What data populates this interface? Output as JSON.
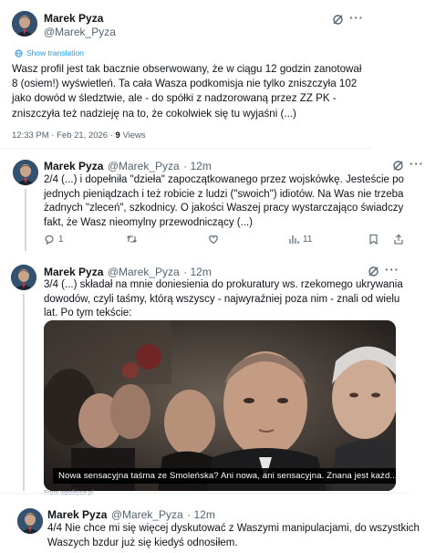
{
  "post1": {
    "author_name": "Marek Pyza",
    "author_handle": "@Marek_Pyza",
    "show_translation": "Show translation",
    "text": "Wasz profil jest tak bacznie obserwowany, że w ciągu 12 godzin zanotował 8 (osiem!) wyświetleń. Ta cała Wasza podkomisja nie tylko zniszczyła 102 jako dowód w śledztwie, ale - do spółki z nadzorowaną przez ZZ PK - zniszczyła też nadzieję na to, że cokolwiek się tu wyjaśni (...)",
    "timestamp": "12:33 PM · Feb 21, 2026 · ",
    "views_count": "9",
    "views_label": " Views"
  },
  "post2": {
    "author_name": "Marek Pyza",
    "author_handle": "@Marek_Pyza",
    "time": "· 12m",
    "text": "2/4 (...) i dopełniła \"dzieła\" zapoczątkowanego przez wojskówkę. Jesteście po jednych pieniądzach i też robicie z ludzi (\"swoich\") idiotów. Na Was nie trzeba żadnych \"zleceń\", szkodnicy. O jakości Waszej pracy wystarczająco świadczy fakt, że Wasz nieomylny przewodniczący (...)",
    "replies": "1",
    "retweets": "",
    "likes": "",
    "views": "11"
  },
  "post3": {
    "author_name": "Marek Pyza",
    "author_handle": "@Marek_Pyza",
    "time": "· 12m",
    "text": "3/4 (...) składał na mnie doniesienia do prokuratury ws. rzekomego ukrywania dowodów, czyli taśmy, którą wszyscy - najwyraźniej poza nim - znali od wielu lat. Po tym tekście:",
    "media_caption": "Nowa sensacyjna taśma ze Smoleńska? Ani nowa, ani sensacyjna. Znana jest każd...",
    "media_source": "From wpolityce.pl"
  },
  "post4": {
    "author_name": "Marek Pyza",
    "author_handle": "@Marek_Pyza",
    "time": "· 12m",
    "text": "4/4 Nie chce mi się więcej dyskutować z Waszymi manipulacjami, do wszystkich Waszych bzdur już się kiedyś odnosiłem."
  },
  "icons": {
    "grok": "grok-slash-icon",
    "more": "more-icon",
    "translate": "translate-globe-icon",
    "reply": "reply-icon",
    "retweet": "retweet-icon",
    "like": "like-icon",
    "views": "views-icon",
    "bookmark": "bookmark-icon",
    "share": "share-icon"
  },
  "colors": {
    "link": "#1d9bf0",
    "secondary_text": "#536471",
    "primary_text": "#0f1419"
  }
}
